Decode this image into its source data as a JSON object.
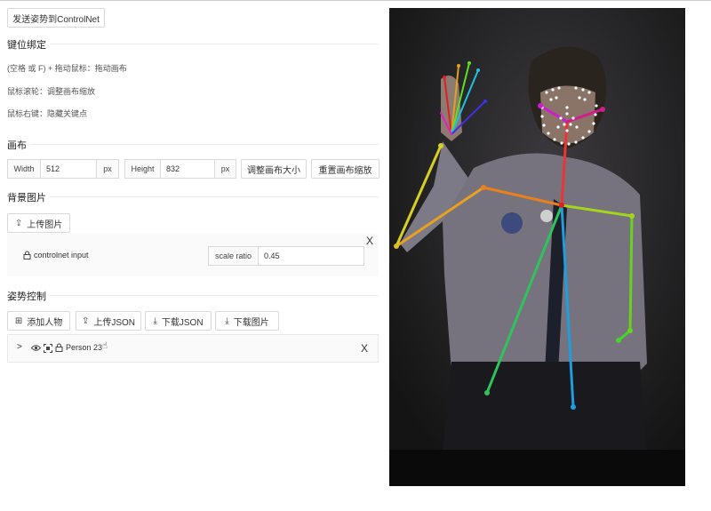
{
  "send_button": "发送姿势到ControlNet",
  "keybind": {
    "title": "键位绑定",
    "lines": [
      "(空格 或 F) + 拖动鼠标：拖动画布",
      "鼠标滚轮：调整画布缩放",
      "鼠标右键：隐藏关键点"
    ]
  },
  "canvas": {
    "title": "画布",
    "width_label": "Width",
    "width_value": "512",
    "height_label": "Height",
    "height_value": "832",
    "unit": "px",
    "resize_button": "调整画布大小",
    "reset_zoom_button": "重置画布缩放"
  },
  "background": {
    "title": "背景图片",
    "upload_button": "上传图片",
    "item_label": "controlnet input",
    "scale_label": "scale ratio",
    "scale_value": "0.45",
    "close_glyph": "X"
  },
  "pose": {
    "title": "姿势控制",
    "add_person": "添加人物",
    "upload_json": "上传JSON",
    "download_json": "下载JSON",
    "download_image": "下载图片",
    "person_name": "Person 23",
    "close_glyph": "X"
  },
  "icons": {
    "lock": "lock-icon",
    "upload": "upload-icon",
    "download": "download-icon",
    "add": "add-square-icon",
    "eye": "eye-icon",
    "expand": "chevron-right-icon",
    "hand": "hand-icon",
    "focus": "focus-icon"
  }
}
